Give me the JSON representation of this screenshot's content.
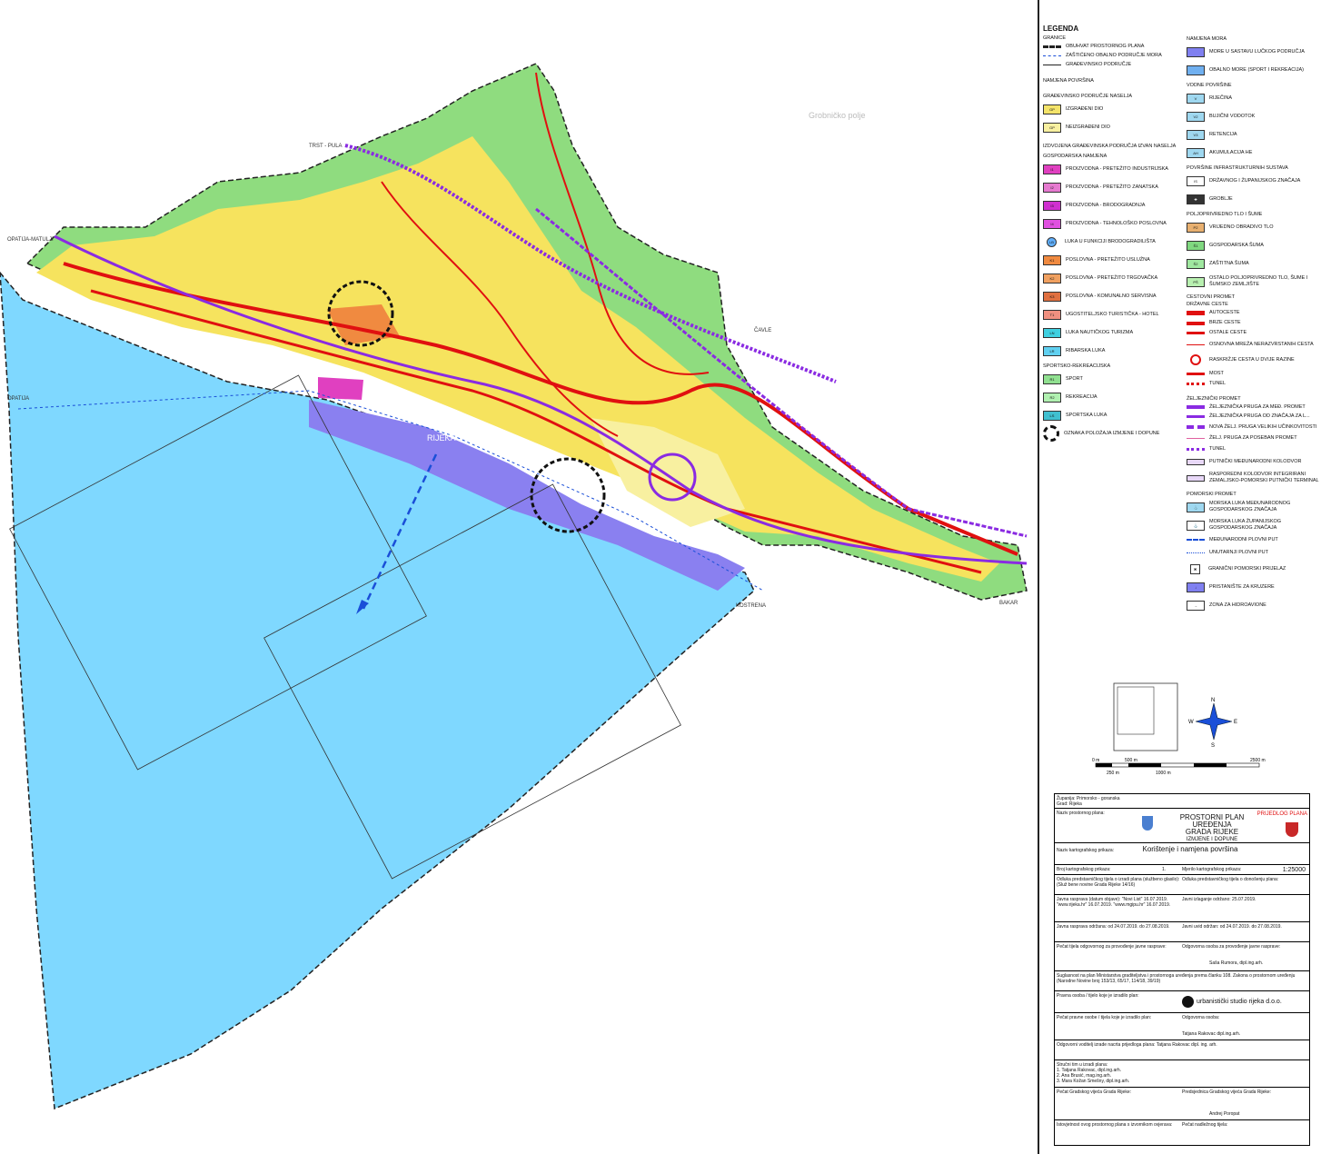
{
  "legend": {
    "title": "LEGENDA",
    "granice": {
      "heading": "GRANICE",
      "items": [
        "OBUHVAT PROSTORNOG PLANA",
        "ZAŠTIĆENO OBALNO PODRUČJE MORA",
        "GRAĐEVINSKO PODRUČJE"
      ]
    },
    "namjena_povrsina": "NAMJENA POVRŠINA",
    "gp_naselja": {
      "heading": "GRAĐEVINSKO PODRUČJE NASELJA",
      "items": [
        {
          "code": "GP",
          "label": "IZGRAĐENI DIO",
          "color": "#f4e46a"
        },
        {
          "code": "GP",
          "label": "NEIZGRAĐENI DIO",
          "color": "#f8f0a0"
        }
      ]
    },
    "izdvojena": "IZDVOJENA GRAĐEVINSKA PODRUČJA IZVAN NASELJA",
    "gospodarska": {
      "heading": "GOSPODARSKA NAMJENA",
      "items": [
        {
          "code": "I1",
          "label": "PROIZVODNA - PRETEŽITO INDUSTRIJSKA",
          "color": "#e040c0"
        },
        {
          "code": "I2",
          "label": "PROIZVODNA - PRETEŽITO ZANATSKA",
          "color": "#e67ad0"
        },
        {
          "code": "I3",
          "label": "PROIZVODNA - BRODOGRADNJA",
          "color": "#d030d0"
        },
        {
          "code": "I4",
          "label": "PROIZVODNA - TEHNOLOŠKO POSLOVNA",
          "color": "#e050e0"
        },
        {
          "code": "LB",
          "label": "LUKA U FUNKCIJI BRODOGRADILIŠTA",
          "color": "#60b0ff"
        },
        {
          "code": "K1",
          "label": "POSLOVNA - PRETEŽITO USLUŽNA",
          "color": "#f08a40"
        },
        {
          "code": "K2",
          "label": "POSLOVNA - PRETEŽITO TRGOVAČKA",
          "color": "#f0a060"
        },
        {
          "code": "K3",
          "label": "POSLOVNA - KOMUNALNO SERVISNA",
          "color": "#e07040"
        },
        {
          "code": "T1",
          "label": "UGOSTITELJSKO TURISTIČKA - HOTEL",
          "color": "#f09080"
        },
        {
          "code": "LN",
          "label": "LUKA NAUTIČKOG TURIZMA",
          "color": "#40d0e0"
        },
        {
          "code": "LR",
          "label": "RIBARSKA LUKA",
          "color": "#60d0f0"
        }
      ]
    },
    "sportska": {
      "heading": "SPORTSKO-REKREACIJSKA",
      "items": [
        {
          "code": "R1",
          "label": "SPORT",
          "color": "#90e090"
        },
        {
          "code": "R2",
          "label": "REKREACIJA",
          "color": "#b0f0b0"
        },
        {
          "code": "LS",
          "label": "SPORTSKA LUKA",
          "color": "#40c0d0"
        }
      ]
    },
    "oznaka": "OZNAKA POLOŽAJA IZMJENE I DOPUNE",
    "namjena_mora": {
      "heading": "NAMJENA MORA",
      "items": [
        {
          "label": "MORE U SASTAVU LUČKOG PODRUČJA",
          "color": "#8080f0"
        },
        {
          "label": "OBALNO MORE (SPORT I REKREACIJA)",
          "color": "#70b0f0"
        }
      ]
    },
    "vodne": {
      "heading": "VODNE POVRŠINE",
      "items": [
        {
          "code": "V",
          "label": "RIJEČINA"
        },
        {
          "code": "V2",
          "label": "BUJIČNI VODOTOK"
        },
        {
          "code": "V3",
          "label": "RETENCIJA"
        },
        {
          "code": "AH",
          "label": "AKUMULACIJA HE"
        }
      ]
    },
    "infra": {
      "heading": "POVRŠINE INFRASTRUKTURNIH SUSTAVA",
      "items": [
        {
          "code": "IS",
          "label": "DRŽAVNOG I ŽUPANIJSKOG ZNAČAJA"
        },
        {
          "code": "✚",
          "label": "GROBLJE"
        }
      ]
    },
    "polj": {
      "heading": "POLJOPRIVREDNO TLO I ŠUME",
      "items": [
        {
          "code": "P2",
          "label": "VRIJEDNO OBRADIVO TLO",
          "color": "#e8b070"
        },
        {
          "code": "Š1",
          "label": "GOSPODARSKA ŠUMA",
          "color": "#80d880"
        },
        {
          "code": "Š2",
          "label": "ZAŠTITNA ŠUMA",
          "color": "#a0e8a0"
        },
        {
          "code": "PŠ",
          "label": "OSTALO POLJOPRIVREDNO TLO, ŠUME I ŠUMSKO ZEMLJIŠTE",
          "color": "#b8f0b0"
        }
      ]
    },
    "cestovni": {
      "heading": "CESTOVNI PROMET",
      "sub": "DRŽAVNE CESTE",
      "items": [
        "AUTOCESTE",
        "BRZE CESTE",
        "OSTALE CESTE",
        "OSNOVNA MREŽA NERAZVRSTANIH CESTA",
        "RASKRIŽJE CESTA U DVIJE RAZINE",
        "MOST",
        "TUNEL"
      ]
    },
    "zeljeznicki": {
      "heading": "ŽELJEZNIČKI PROMET",
      "items": [
        "ŽELJEZNIČKA PRUGA ZA MEĐ. PROMET",
        "ŽELJEZNIČKA PRUGA OD ZNAČAJA ZA L...",
        "NOVA ŽELJ. PRUGA VELIKIH UČINKOVITOSTI",
        "ŽELJ. PRUGA ZA POSEBAN PROMET",
        "TUNEL",
        "PUTNIČKI MEĐUNARODNI KOLODVOR",
        "RASPOREDNI KOLODVOR INTEGRIRANI ZEMALJSKO-POMORSKI PUTNIČKI TERMINAL"
      ]
    },
    "pomorski": {
      "heading": "POMORSKI PROMET",
      "items": [
        "MORSKA LUKA MEĐUNARODNOG GOSPODARSKOG ZNAČAJA",
        "MORSKA LUKA ŽUPANIJSKOG GOSPODARSKOG ZNAČAJA",
        "MEĐUNARODNI PLOVNI PUT",
        "UNUTARNJI PLOVNI PUT",
        "GRANIČNI POMORSKI PRIJELAZ",
        "PRISTANIŠTE ZA KRUZERE",
        "ZONA ZA HIDROAVIONE"
      ]
    }
  },
  "map": {
    "colors": {
      "sea": "#7fd8ff",
      "port_sea": "#8a80f0",
      "urban": "#f6e35e",
      "urban_light": "#f8f0a0",
      "forest": "#8fdc7f",
      "forest_light": "#b8eeb0",
      "road": "#e01010",
      "rail": "#8a2be2",
      "boundary": "#222"
    },
    "labels": {
      "city": "RIJEKA",
      "opatija": "OPATIJA",
      "opatija_matulji": "OPATIJA-MATULJI",
      "kostrena": "KOSTRENA",
      "trst_pula": "TRST - PULA",
      "cavle": "ČAVLE",
      "bakar": "BAKAR",
      "grobnicko_polje": "Grobničko polje"
    }
  },
  "scale": {
    "units": [
      "0 m",
      "500 m",
      "2500 m",
      "250 m",
      "1000 m"
    ],
    "north": "N",
    "south": "S",
    "east": "E",
    "west": "W"
  },
  "title_block": {
    "zupanija_label": "Županija:",
    "zupanija": "Primorsko - goranska",
    "grad_label": "Grad:",
    "grad": "Rijeka",
    "naziv_label": "Naziv prostornog plana:",
    "prijedlog": "PRIJEDLOG PLANA",
    "plan_title": "PROSTORNI PLAN UREĐENJA",
    "plan_title2": "GRADA RIJEKE",
    "plan_sub": "IZMJENE I DOPUNE",
    "karta_label": "Naziv kartografskog prikaza:",
    "karta": "Korištenje i namjena površina",
    "broj_label": "Broj kartografskog prikaza:",
    "broj": "1.",
    "mjerilo_label": "Mjerilo kartografskog prikaza:",
    "mjerilo": "1:25000",
    "odluka": "Odluka predstavničkog tijela o izradi plana (službeno glasilo): (Služ bene novine Grada Rijeke 14/16)",
    "odluka2": "Odluka predstavničkog tijela o donošenju plana:",
    "javna": "Javna rasprava (datum objave): \"Novi List\" 16.07.2019. \"www.rijeka.hr\" 16.07.2019. \"www.mgipu.hr\" 16.07.2019.",
    "javni_uvid": "Javni izlaganje održano: 25.07.2019.",
    "rasprava": "Javna rasprava održana: od 24.07.2019. do 27.08.2019.",
    "uvid": "Javni uvid održan: od 24.07.2019. do 27.08.2019.",
    "pecat": "Pečat tijela odgovornog za provođenje javne rasprave:",
    "odgovorna": "Odgovorna osoba za provođenje javne rasprave:",
    "odgovorna_ime": "Saša Rumora, dipl.ing.arh.",
    "suglasnost": "Suglasnost na plan Ministarstva graditeljstva i prostornoga uređenja prema članku 108. Zakona o prostornom uređenju (Narodne Novine broj 153/13, 65/17, 114/18, 39/19)",
    "pravna": "Pravna osoba / tijelo koje je izradilo plan:",
    "studio": "urbanistički studio rijeka d.o.o.",
    "pecat2": "Pečat pravne osobe / tijela koje je izradilo plan:",
    "odgovorna2": "Odgovorna osoba:",
    "odgovorna2_ime": "Tatjana Rakovac dipl.ing.arh.",
    "koordinator": "Odgovorni voditelj izrade nacrta prijedloga plana: Tatjana Rakovac dipl. ing. arh.",
    "tim_label": "Stručni tim u izradi plana:",
    "tim": [
      "1. Tatjana Rakovac, dipl.ing.arh.",
      "2. Ana Brusić, mag.ing.arh.",
      "3. Mara Kožan Smešny, dipl.ing.arh."
    ],
    "pecat_vijeca": "Pečat Gradskog vijeća Grada Rijeke:",
    "predsjednik": "Predsjednica Gradskog vijeća Grada Rijeke:",
    "predsjednik_ime": "Andrej Poropat",
    "istovjetnost": "Istovjetnost ovog prostornog plana s izvornikom ovjerava:",
    "nadlezno": "Pečat nadležnog tijela:"
  }
}
